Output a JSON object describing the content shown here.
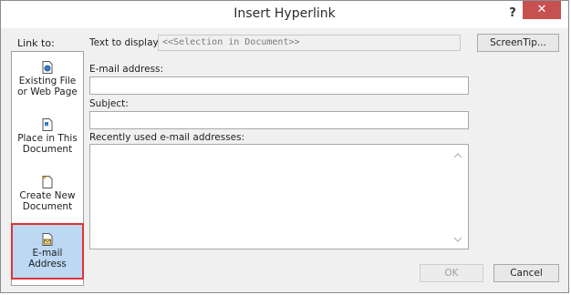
{
  "titlebar": {
    "title": "Insert Hyperlink",
    "help": "?",
    "close": "✕"
  },
  "link_to": {
    "label": "Link to:",
    "items": [
      {
        "name": "existing-file",
        "label_line1": "Existing File",
        "label_line2": "or Web Page",
        "icon": "document-globe-icon"
      },
      {
        "name": "place-in-document",
        "label_line1": "Place in This",
        "label_line2": "Document",
        "icon": "document-pin-icon"
      },
      {
        "name": "create-new-document",
        "label_line1": "Create New",
        "label_line2": "Document",
        "icon": "new-document-icon"
      },
      {
        "name": "email-address",
        "label_line1": "E-mail",
        "label_line2": "Address",
        "icon": "email-document-icon",
        "selected": true
      }
    ]
  },
  "text_to_display": {
    "label": "Text to display:",
    "value": "<<Selection in Document>>"
  },
  "screentip": {
    "label": "ScreenTip..."
  },
  "email": {
    "label": "E-mail address:",
    "value": ""
  },
  "subject": {
    "label": "Subject:",
    "value": ""
  },
  "recent": {
    "label": "Recently used e-mail addresses:"
  },
  "buttons": {
    "ok": "OK",
    "cancel": "Cancel"
  },
  "colors": {
    "close": "#c75050",
    "selection": "#bcd8f2",
    "highlight_border": "#e23137"
  }
}
